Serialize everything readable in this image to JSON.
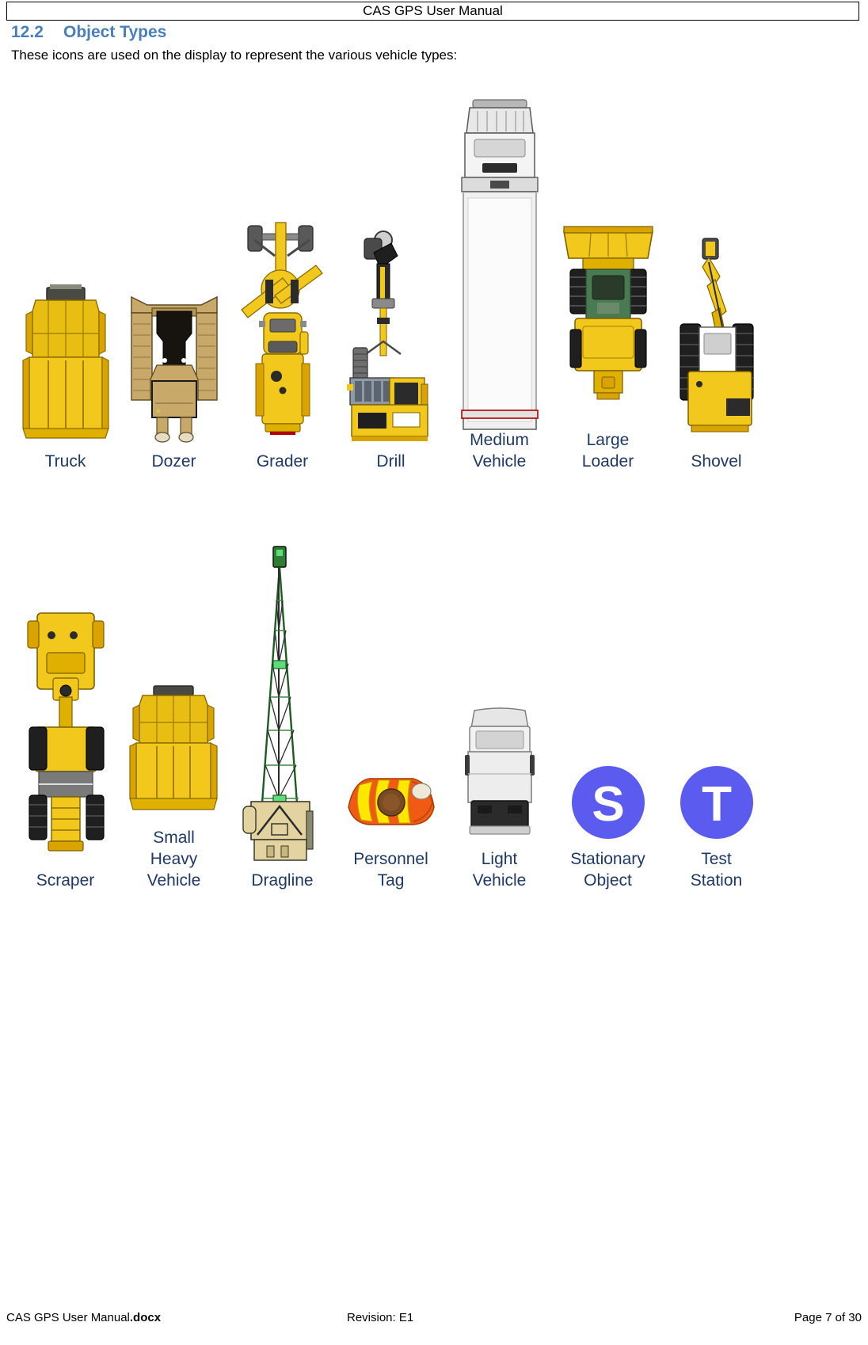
{
  "header": {
    "title": "CAS GPS User Manual"
  },
  "section": {
    "number": "12.2",
    "title": "Object Types"
  },
  "intro": {
    "text": "These icons are used on the display to represent the various vehicle types:"
  },
  "colors": {
    "heading_blue": "#4A7EBB",
    "label_navy": "#1F3864",
    "vehicle_yellow": "#F2C200",
    "vehicle_gold": "#D9A300",
    "dozer_tan": "#C8A96A",
    "dragline_green": "#2E7D32",
    "dragline_body": "#E3D3A0",
    "marker_purple": "#5B5BF0",
    "tag_orange": "#F05A14",
    "light_vehicle_grey": "#D8D8D8",
    "dark_grey": "#3A3A3A"
  },
  "object_types": {
    "row1": [
      {
        "label": "Truck",
        "icon": "haul-truck-icon",
        "glyph": ""
      },
      {
        "label": "Dozer",
        "icon": "dozer-icon",
        "glyph": ""
      },
      {
        "label": "Grader",
        "icon": "grader-icon",
        "glyph": ""
      },
      {
        "label": "Drill",
        "icon": "drill-icon",
        "glyph": ""
      },
      {
        "label": "Medium\nVehicle",
        "icon": "medium-vehicle-icon",
        "glyph": ""
      },
      {
        "label": "Large\nLoader",
        "icon": "large-loader-icon",
        "glyph": ""
      },
      {
        "label": "Shovel",
        "icon": "shovel-icon",
        "glyph": ""
      }
    ],
    "row2": [
      {
        "label": "Scraper",
        "icon": "scraper-icon",
        "glyph": ""
      },
      {
        "label": "Small\nHeavy\nVehicle",
        "icon": "small-heavy-vehicle-icon",
        "glyph": ""
      },
      {
        "label": "Dragline",
        "icon": "dragline-icon",
        "glyph": ""
      },
      {
        "label": "Personnel\nTag",
        "icon": "personnel-tag-icon",
        "glyph": ""
      },
      {
        "label": "Light\nVehicle",
        "icon": "light-vehicle-icon",
        "glyph": ""
      },
      {
        "label": "Stationary\nObject",
        "icon": "stationary-object-icon",
        "glyph": "S"
      },
      {
        "label": "Test\nStation",
        "icon": "test-station-icon",
        "glyph": "T"
      }
    ]
  },
  "footer": {
    "left_normal": "CAS GPS User Manual",
    "left_bold": ".docx",
    "center": "Revision: E1",
    "right": "Page 7 of 30"
  }
}
